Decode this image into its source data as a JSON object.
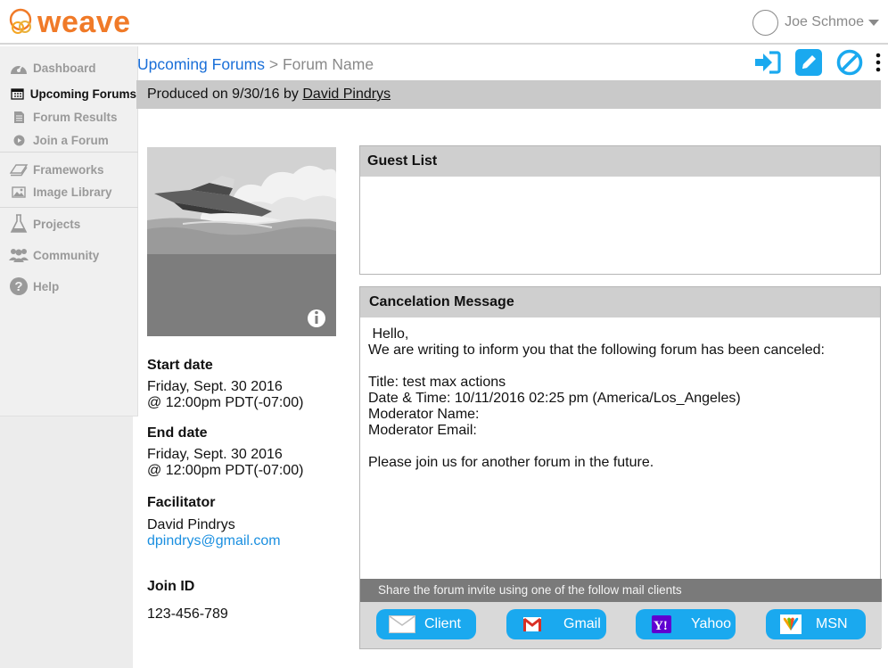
{
  "brand": {
    "name": "weave",
    "color": "#f07a28"
  },
  "user": {
    "name": "Joe Schmoe"
  },
  "sidebar": {
    "items": [
      {
        "label": "Dashboard",
        "icon": "gauge-icon"
      },
      {
        "label": "Upcoming Forums",
        "icon": "calendar-icon"
      },
      {
        "label": "Forum Results",
        "icon": "document-icon"
      },
      {
        "label": "Join a Forum",
        "icon": "play-circle-icon"
      },
      {
        "label": "Frameworks",
        "icon": "layers-icon"
      },
      {
        "label": "Image Library",
        "icon": "image-icon"
      },
      {
        "label": "Projects",
        "icon": "flask-icon"
      },
      {
        "label": "Community",
        "icon": "people-icon"
      },
      {
        "label": "Help",
        "icon": "question-icon"
      }
    ]
  },
  "breadcrumb": {
    "parent": "Upcoming Forums",
    "separator": ">",
    "current": "Forum Name"
  },
  "actions": {
    "accent": "#1aa9ef",
    "icons": [
      "sign-in-icon",
      "edit-icon",
      "cancel-icon",
      "more-vertical-icon"
    ]
  },
  "produced": {
    "prefix": "Produced on 9/30/16 by",
    "author": "David Pindrys"
  },
  "details": {
    "start_label": "Start date",
    "start_line1": "Friday, Sept. 30 2016",
    "start_line2": "@ 12:00pm PDT(-07:00)",
    "end_label": "End date",
    "end_line1": "Friday, Sept. 30 2016",
    "end_line2": "@ 12:00pm PDT(-07:00)",
    "facilitator_label": "Facilitator",
    "facilitator_name": "David Pindrys",
    "facilitator_email": "dpindrys@gmail.com",
    "join_label": "Join ID",
    "join_id": "123-456-789"
  },
  "guest_list": {
    "title": "Guest List"
  },
  "cancel_message": {
    "title": "Cancelation Message",
    "body": " Hello,\nWe are writing to inform you that the following forum has been canceled:\n\nTitle: test max actions\nDate & Time: 10/11/2016 02:25 pm (America/Los_Angeles)\nModerator Name:\nModerator Email:\n\nPlease join us for another forum in the future."
  },
  "share": {
    "text": "Share the forum invite using one of the follow mail clients",
    "buttons": [
      {
        "label": "Client",
        "icon": "envelope-icon"
      },
      {
        "label": "Gmail",
        "icon": "gmail-icon"
      },
      {
        "label": "Yahoo",
        "icon": "yahoo-icon"
      },
      {
        "label": "MSN",
        "icon": "msn-icon"
      }
    ]
  }
}
